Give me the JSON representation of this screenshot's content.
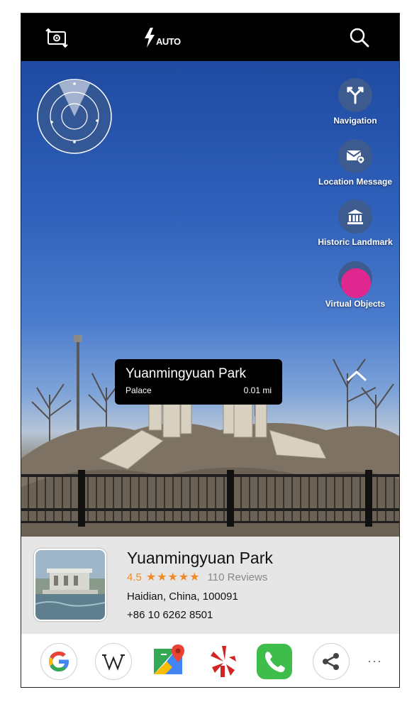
{
  "camera_bar": {
    "rotate_icon": "camera-rotate-icon",
    "flash_label": "AUTO",
    "search_icon": "search-icon"
  },
  "side_menu": [
    {
      "label": "Navigation",
      "icon": "navigation-fork-icon"
    },
    {
      "label": "Location Message",
      "icon": "location-message-icon"
    },
    {
      "label": "Historic Landmark",
      "icon": "landmark-icon"
    },
    {
      "label": "Virtual Objects",
      "icon": "virtual-objects-icon"
    }
  ],
  "ar_label": {
    "title": "Yuanmingyuan Park",
    "category": "Palace",
    "distance": "0.01 mi"
  },
  "place": {
    "name": "Yuanmingyuan Park",
    "rating": "4.5",
    "stars": "★★★★★",
    "reviews": "110 Reviews",
    "address": "Haidian, China, 100091",
    "phone": "+86 10 6262 8501"
  },
  "apps": [
    {
      "name": "google-app-icon"
    },
    {
      "name": "wikipedia-app-icon"
    },
    {
      "name": "google-maps-app-icon"
    },
    {
      "name": "yelp-app-icon"
    },
    {
      "name": "phone-app-icon"
    },
    {
      "name": "share-icon"
    }
  ],
  "more_label": "···",
  "colors": {
    "accent_orange": "#f08a24",
    "side_button": "#3d5b8e",
    "highlight_pink": "#e0268f"
  }
}
